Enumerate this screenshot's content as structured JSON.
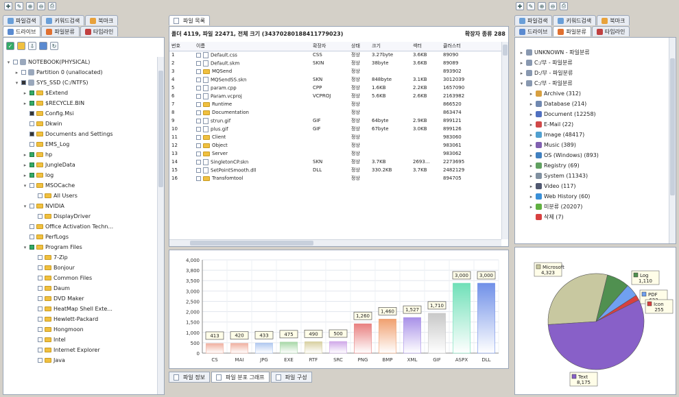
{
  "left": {
    "tabs_row1": [
      {
        "label": "파일검색",
        "icon": "search-file-icon",
        "color": "#6a9fd8"
      },
      {
        "label": "키워드검색",
        "icon": "keyword-search-icon",
        "color": "#6a9fd8"
      },
      {
        "label": "북마크",
        "icon": "bookmark-icon",
        "color": "#e8a23c"
      }
    ],
    "tabs_row2": [
      {
        "label": "드라이브",
        "icon": "drive-icon",
        "color": "#5a8ad0"
      },
      {
        "label": "파일분류",
        "icon": "file-category-icon",
        "color": "#e07030"
      },
      {
        "label": "타임라인",
        "icon": "timeline-icon",
        "color": "#c04040"
      }
    ],
    "tree": [
      {
        "label": "NOTEBOOK(PHYSICAL)",
        "indent": 0,
        "check": "none",
        "kind": "drive",
        "expand": "▾"
      },
      {
        "label": "Partition 0 (unallocated)",
        "indent": 1,
        "check": "none",
        "kind": "drive",
        "expand": "▸"
      },
      {
        "label": "SYS_SSD (C:/NTFS)",
        "indent": 1,
        "check": "partial",
        "kind": "drive",
        "expand": "▾"
      },
      {
        "label": "$Extend",
        "indent": 2,
        "check": "checked",
        "kind": "folder",
        "expand": "▸"
      },
      {
        "label": "$RECYCLE.BIN",
        "indent": 2,
        "check": "checked",
        "kind": "folder",
        "expand": "▸"
      },
      {
        "label": "Config.Msi",
        "indent": 2,
        "check": "partial",
        "kind": "folder",
        "expand": ""
      },
      {
        "label": "Dkwin",
        "indent": 2,
        "check": "none",
        "kind": "folder",
        "expand": ""
      },
      {
        "label": "Documents and Settings",
        "indent": 2,
        "check": "partial",
        "kind": "folder",
        "expand": ""
      },
      {
        "label": "EMS_Log",
        "indent": 2,
        "check": "none",
        "kind": "folder",
        "expand": ""
      },
      {
        "label": "hp",
        "indent": 2,
        "check": "checked",
        "kind": "folder",
        "expand": "▸"
      },
      {
        "label": "JungleData",
        "indent": 2,
        "check": "checked",
        "kind": "folder",
        "expand": "▸"
      },
      {
        "label": "log",
        "indent": 2,
        "check": "checked",
        "kind": "folder",
        "expand": "▸"
      },
      {
        "label": "MSOCache",
        "indent": 2,
        "check": "none",
        "kind": "folder",
        "expand": "▾"
      },
      {
        "label": "All Users",
        "indent": 3,
        "check": "none",
        "kind": "folder",
        "expand": ""
      },
      {
        "label": "NVIDIA",
        "indent": 2,
        "check": "none",
        "kind": "folder",
        "expand": "▾"
      },
      {
        "label": "DisplayDriver",
        "indent": 3,
        "check": "none",
        "kind": "folder",
        "expand": ""
      },
      {
        "label": "Office Activation Techn...",
        "indent": 2,
        "check": "none",
        "kind": "folder",
        "expand": ""
      },
      {
        "label": "PerfLogs",
        "indent": 2,
        "check": "none",
        "kind": "folder",
        "expand": ""
      },
      {
        "label": "Program Files",
        "indent": 2,
        "check": "checked",
        "kind": "folder",
        "expand": "▾"
      },
      {
        "label": "7-Zip",
        "indent": 3,
        "check": "none",
        "kind": "folder",
        "expand": ""
      },
      {
        "label": "Bonjour",
        "indent": 3,
        "check": "none",
        "kind": "folder",
        "expand": ""
      },
      {
        "label": "Common Files",
        "indent": 3,
        "check": "none",
        "kind": "folder",
        "expand": ""
      },
      {
        "label": "Daum",
        "indent": 3,
        "check": "none",
        "kind": "folder",
        "expand": ""
      },
      {
        "label": "DVD Maker",
        "indent": 3,
        "check": "none",
        "kind": "folder",
        "expand": ""
      },
      {
        "label": "HeatMap Shell Exte...",
        "indent": 3,
        "check": "none",
        "kind": "folder",
        "expand": ""
      },
      {
        "label": "Hewlett-Packard",
        "indent": 3,
        "check": "none",
        "kind": "folder",
        "expand": ""
      },
      {
        "label": "Hongmoon",
        "indent": 3,
        "check": "none",
        "kind": "folder",
        "expand": ""
      },
      {
        "label": "Intel",
        "indent": 3,
        "check": "none",
        "kind": "folder",
        "expand": ""
      },
      {
        "label": "Internet Explorer",
        "indent": 3,
        "check": "none",
        "kind": "folder",
        "expand": ""
      },
      {
        "label": "Java",
        "indent": 3,
        "check": "none",
        "kind": "folder",
        "expand": ""
      }
    ]
  },
  "center": {
    "tab_label": "파일 목록",
    "summary": "폴더 4119, 파일 22471, 전체 크기 (34370280188411779023)",
    "summary_right": "확장자 종류 288",
    "columns": [
      "번호",
      "이름",
      "확장자",
      "상태",
      "크기",
      "섹터",
      "클러스터"
    ],
    "rows": [
      [
        "1",
        "Default.css",
        "CSS",
        "정상",
        "3.27byte",
        "3.6KB",
        "89090"
      ],
      [
        "2",
        "Default.skm",
        "SKIN",
        "정상",
        "38byte",
        "3.6KB",
        "89089"
      ],
      [
        "3",
        "MQSend",
        "",
        "정상",
        "",
        "",
        "893902"
      ],
      [
        "4",
        "MQSendSS.skn",
        "SKN",
        "정상",
        "848byte",
        "3.1KB",
        "3012039"
      ],
      [
        "5",
        "param.cpp",
        "CPP",
        "정상",
        "1.6KB",
        "2.2KB",
        "1657090"
      ],
      [
        "6",
        "Param.vcproj",
        "VCPROJ",
        "정상",
        "5.6KB",
        "2.6KB",
        "2163982"
      ],
      [
        "7",
        "Runtime",
        "",
        "정상",
        "",
        "",
        "866520"
      ],
      [
        "8",
        "Documentation",
        "",
        "정상",
        "",
        "",
        "863474"
      ],
      [
        "9",
        "strun.gif",
        "GIF",
        "정상",
        "64byte",
        "2.9KB",
        "899121"
      ],
      [
        "10",
        "plus.gif",
        "GIF",
        "정상",
        "67byte",
        "3.0KB",
        "899126"
      ],
      [
        "11",
        "Client",
        "",
        "정상",
        "",
        "",
        "983060"
      ],
      [
        "12",
        "Object",
        "",
        "정상",
        "",
        "",
        "983061"
      ],
      [
        "13",
        "Server",
        "",
        "정상",
        "",
        "",
        "983062"
      ],
      [
        "14",
        "SingletonCP.skn",
        "SKN",
        "정상",
        "3.7KB",
        "2693...",
        "2273695"
      ],
      [
        "15",
        "SetPointSmooth.dll",
        "DLL",
        "정상",
        "330.2KB",
        "3.7KB",
        "2482129"
      ],
      [
        "16",
        "Transfomtool",
        "",
        "정상",
        "",
        "",
        "894705"
      ]
    ],
    "bottom_tabs": [
      {
        "label": "파일 정보",
        "icon": "file-info-icon"
      },
      {
        "label": "파일 분포 그래프",
        "icon": "distribution-graph-icon"
      },
      {
        "label": "파일 구성",
        "icon": "file-structure-icon"
      }
    ]
  },
  "right": {
    "tabs_row1": [
      {
        "label": "파일검색",
        "icon": "search-file-icon",
        "color": "#6a9fd8"
      },
      {
        "label": "키워드검색",
        "icon": "keyword-search-icon",
        "color": "#6a9fd8"
      },
      {
        "label": "북마크",
        "icon": "bookmark-icon",
        "color": "#e8a23c"
      }
    ],
    "tabs_row2": [
      {
        "label": "드라이브",
        "icon": "drive-icon",
        "color": "#5a8ad0"
      },
      {
        "label": "파일분류",
        "icon": "file-category-icon",
        "color": "#e07030"
      },
      {
        "label": "타임라인",
        "icon": "timeline-icon",
        "color": "#c04040"
      }
    ],
    "tree": [
      {
        "label": "UNKNOWN - 파일분류",
        "indent": 0,
        "expand": "▸",
        "icon": "drive-icon",
        "color": "#8898b0"
      },
      {
        "label": "C:/부 - 파일분류",
        "indent": 0,
        "expand": "▸",
        "icon": "drive-icon",
        "color": "#8898b0"
      },
      {
        "label": "D:/부 - 파일분류",
        "indent": 0,
        "expand": "▸",
        "icon": "drive-icon",
        "color": "#8898b0"
      },
      {
        "label": "C:/부 - 파일분류",
        "indent": 0,
        "expand": "▾",
        "icon": "drive-icon",
        "color": "#8898b0"
      },
      {
        "label": "Archive (312)",
        "indent": 1,
        "expand": "▸",
        "icon": "archive-icon",
        "color": "#d8a040"
      },
      {
        "label": "Database (214)",
        "indent": 1,
        "expand": "▸",
        "icon": "database-icon",
        "color": "#7088b0"
      },
      {
        "label": "Document (12258)",
        "indent": 1,
        "expand": "▸",
        "icon": "document-icon",
        "color": "#5070c0"
      },
      {
        "label": "E-Mail (22)",
        "indent": 1,
        "expand": "▸",
        "icon": "email-icon",
        "color": "#d04848"
      },
      {
        "label": "Image (48417)",
        "indent": 1,
        "expand": "▸",
        "icon": "image-icon",
        "color": "#50a0d0"
      },
      {
        "label": "Music (389)",
        "indent": 1,
        "expand": "▸",
        "icon": "music-icon",
        "color": "#8060b0"
      },
      {
        "label": "OS (Windows) (893)",
        "indent": 1,
        "expand": "▸",
        "icon": "windows-icon",
        "color": "#4080c0"
      },
      {
        "label": "Registry (69)",
        "indent": 1,
        "expand": "▸",
        "icon": "registry-icon",
        "color": "#60a060"
      },
      {
        "label": "System (11343)",
        "indent": 1,
        "expand": "▸",
        "icon": "system-icon",
        "color": "#8090a0"
      },
      {
        "label": "Video (117)",
        "indent": 1,
        "expand": "▸",
        "icon": "video-icon",
        "color": "#505870"
      },
      {
        "label": "Web History (60)",
        "indent": 1,
        "expand": "▸",
        "icon": "web-history-icon",
        "color": "#3a90d8"
      },
      {
        "label": "미분류 (20207)",
        "indent": 1,
        "expand": "▸",
        "icon": "unclassified-icon",
        "color": "#60b040"
      },
      {
        "label": "삭제 (7)",
        "indent": 1,
        "expand": "",
        "icon": "deleted-icon",
        "color": "#d84040"
      }
    ]
  },
  "chart_data": [
    {
      "type": "bar",
      "categories": [
        "CS",
        "MAI",
        "JPG",
        "EXE",
        "RTF",
        "SRC",
        "PNG",
        "BMP",
        "XML",
        "GIF",
        "ASPX",
        "DLL"
      ],
      "values": [
        413,
        420,
        433,
        475,
        490,
        500,
        1260,
        1460,
        1527,
        1710,
        3000,
        3000
      ],
      "value_labels": [
        "413",
        "420",
        "433",
        "475",
        "490",
        "500",
        "1,260",
        "1,460",
        "1,527",
        "1,710",
        "3,000",
        "3,000"
      ],
      "ytick_labels": [
        "4,000",
        "3,800",
        "3,500",
        "3,000",
        "2,500",
        "2,000",
        "1,500",
        "1,000",
        "500",
        "0"
      ],
      "colors": [
        "#f0b0a0",
        "#f0b0a0",
        "#b0c8f0",
        "#a8d8a8",
        "#d8d0a0",
        "#d0a8e8",
        "#e88080",
        "#f0a070",
        "#a890e8",
        "#c8c8c8",
        "#70e0b8",
        "#7090e8"
      ],
      "ylim": [
        0,
        4000
      ],
      "grid": true
    },
    {
      "type": "pie",
      "labels": [
        "Microsoft",
        "Log",
        "PDF",
        "Icon",
        "Text"
      ],
      "value_labels": [
        "4,323",
        "1,110",
        "623",
        "255",
        "8,175"
      ],
      "values": [
        4323,
        1110,
        623,
        255,
        8175
      ],
      "colors": [
        "#c8c8a0",
        "#509050",
        "#70a0f0",
        "#d84040",
        "#8860c8"
      ]
    }
  ]
}
